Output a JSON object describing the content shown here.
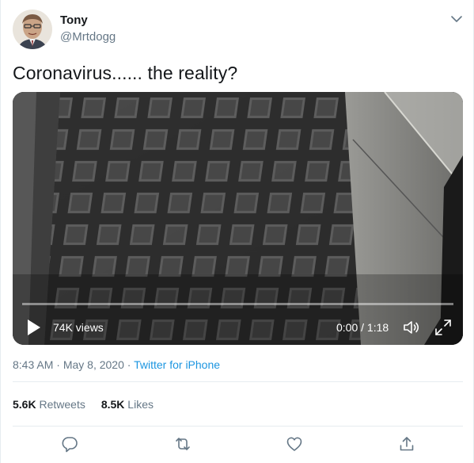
{
  "author": {
    "name": "Tony",
    "handle": "@Mrtdogg"
  },
  "tweet": {
    "text": "Coronavirus...... the reality?"
  },
  "video": {
    "views": "74K views",
    "time": "0:00 / 1:18",
    "progress_fraction": 0
  },
  "meta": {
    "time": "8:43 AM",
    "sep1": " · ",
    "date": "May 8, 2020",
    "sep2": " · ",
    "source": "Twitter for iPhone"
  },
  "stats": {
    "retweets_count": "5.6K",
    "retweets_label": "Retweets",
    "likes_count": "8.5K",
    "likes_label": "Likes"
  },
  "icons": {
    "caret": "chevron-down-icon",
    "play": "play-icon",
    "volume": "volume-icon",
    "fullscreen": "fullscreen-icon",
    "reply": "reply-icon",
    "retweet": "retweet-icon",
    "like": "heart-icon",
    "share": "share-icon"
  },
  "colors": {
    "link": "#1b95e0",
    "secondary": "#657786",
    "icon": "#657786"
  }
}
